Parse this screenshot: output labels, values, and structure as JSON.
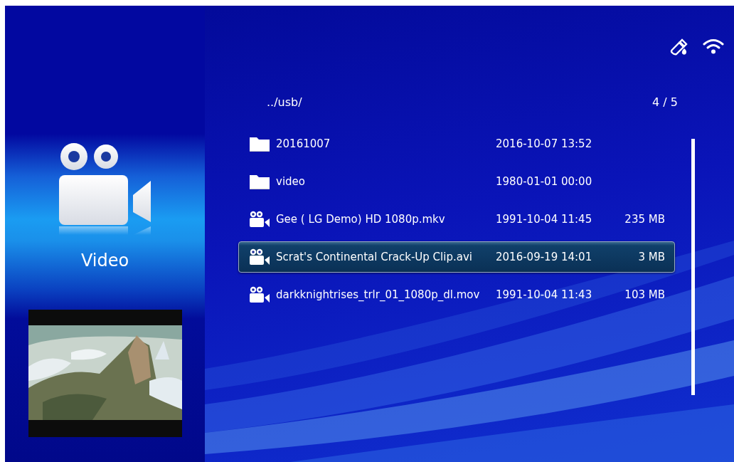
{
  "path": "../usb/",
  "page": "4 / 5",
  "category": {
    "label": "Video"
  },
  "files": [
    {
      "kind": "folder",
      "name": "20161007",
      "date": "2016-10-07 13:52",
      "selected": false
    },
    {
      "kind": "folder",
      "name": "video",
      "date": "1980-01-01 00:00",
      "selected": false
    },
    {
      "kind": "video",
      "name": "Gee ( LG Demo) HD 1080p.mkv",
      "date": "1991-10-04 11:45",
      "size": "235 MB",
      "selected": false
    },
    {
      "kind": "video",
      "name": "Scrat's Continental Crack-Up Clip.avi",
      "date": "2016-09-19 14:01",
      "size": "3 MB",
      "selected": true
    },
    {
      "kind": "video",
      "name": "darkknightrises_trlr_01_1080p_dl.mov",
      "date": "1991-10-04 11:43",
      "size": "103 MB",
      "selected": false
    }
  ]
}
